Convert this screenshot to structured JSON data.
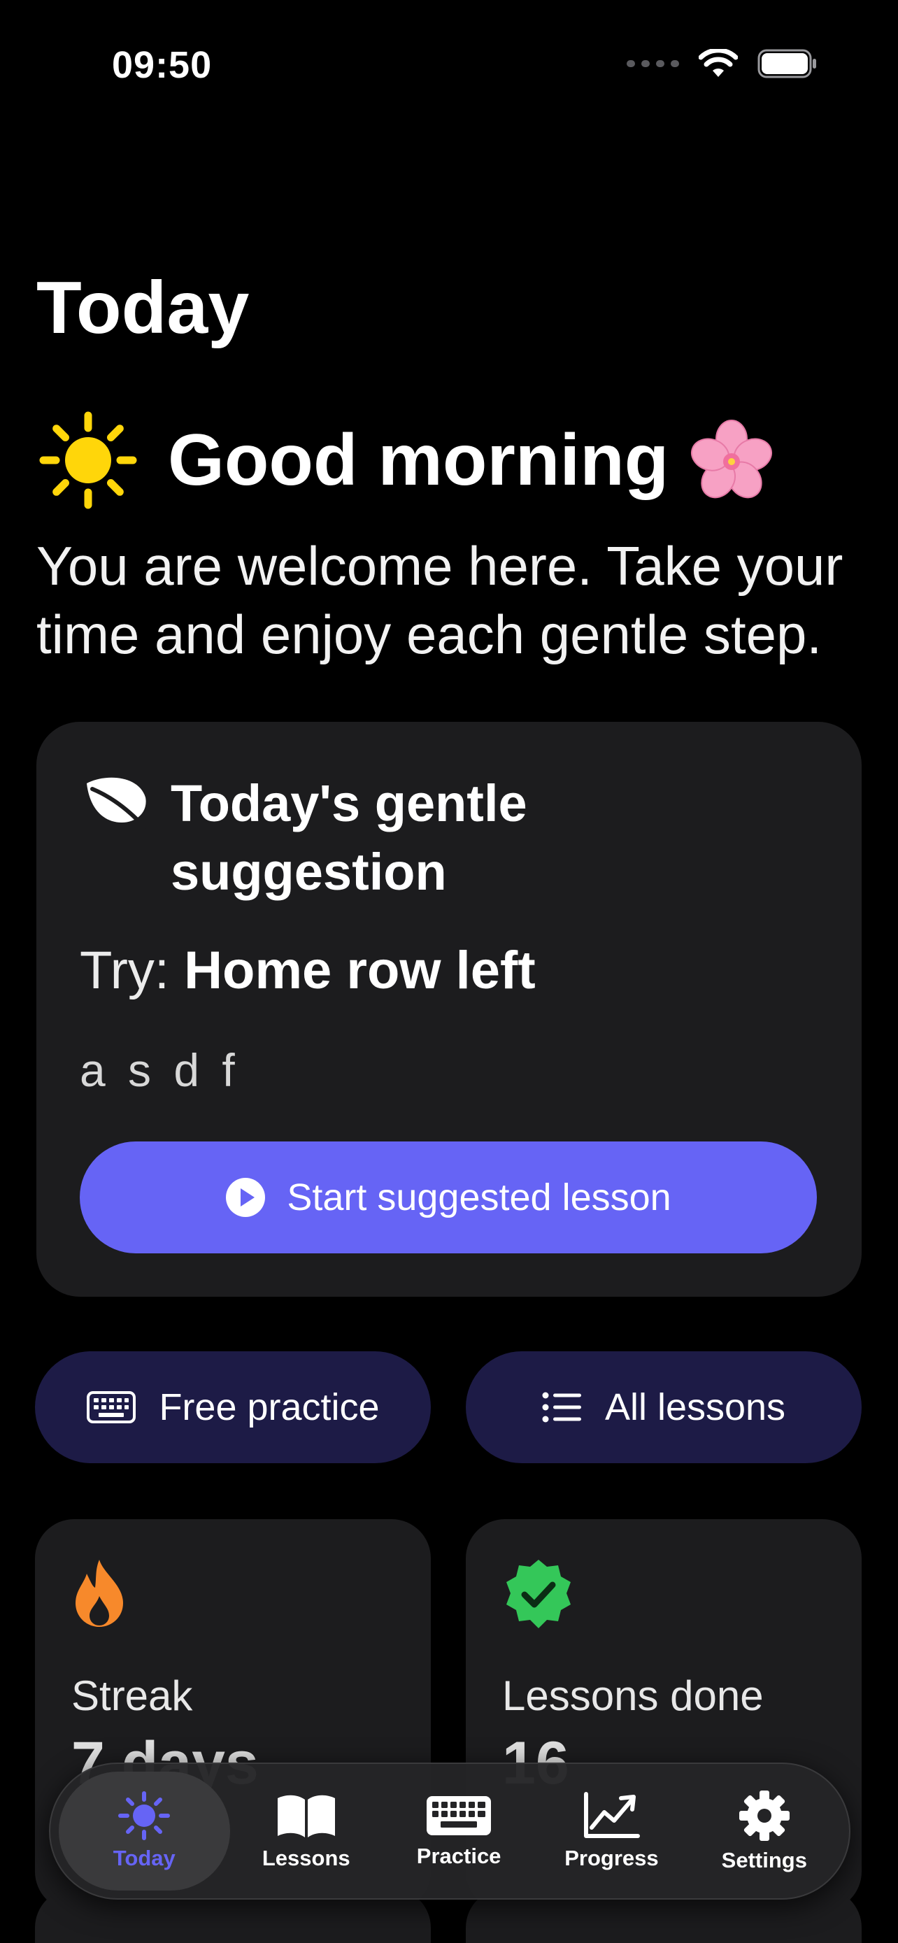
{
  "status_bar": {
    "time": "09:50"
  },
  "header": {
    "title": "Today"
  },
  "greeting": {
    "text": "Good morning"
  },
  "welcome_text": "You are welcome here. Take your time and enjoy each gentle step.",
  "suggestion": {
    "title": "Today's gentle suggestion",
    "try_prefix": "Try:",
    "lesson_name": "Home row left",
    "keys": "a s d f",
    "start_label": "Start suggested lesson"
  },
  "quick_actions": {
    "free_practice": "Free practice",
    "all_lessons": "All lessons"
  },
  "stats": [
    {
      "label": "Streak",
      "value": "7 days"
    },
    {
      "label": "Lessons done",
      "value": "16"
    }
  ],
  "tabbar": {
    "items": [
      {
        "label": "Today",
        "icon": "sun-icon",
        "active": true
      },
      {
        "label": "Lessons",
        "icon": "book-icon",
        "active": false
      },
      {
        "label": "Practice",
        "icon": "keyboard-icon",
        "active": false
      },
      {
        "label": "Progress",
        "icon": "chart-icon",
        "active": false
      },
      {
        "label": "Settings",
        "icon": "gear-icon",
        "active": false
      }
    ]
  },
  "colors": {
    "accent": "#6664f5",
    "card": "#1c1c1e",
    "pill": "#1d1b46",
    "flame": "#f7892b",
    "check": "#34c759",
    "sun": "#ffd60a"
  }
}
